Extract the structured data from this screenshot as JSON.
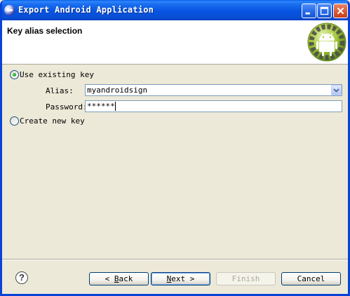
{
  "window": {
    "title": "Export Android Application"
  },
  "header": {
    "title": "Key alias selection"
  },
  "options": {
    "use_existing_label": "Use existing key",
    "create_new_label": "Create new key",
    "selected": "use_existing"
  },
  "form": {
    "alias_label": "Alias:",
    "alias_value": "myandroidsign",
    "password_label": "Password:",
    "password_value": "******"
  },
  "buttons": {
    "help": "?",
    "back_prefix": "< ",
    "back_key": "B",
    "back_rest": "ack",
    "next_key": "N",
    "next_rest": "ext >",
    "finish": "Finish",
    "cancel": "Cancel"
  },
  "icons": {
    "title": "eclipse-icon",
    "header": "android-logo-icon"
  },
  "colors": {
    "titlebar": "#0A4FD6",
    "dialog_bg": "#ECE9D8",
    "android_green": "#A4C639"
  }
}
